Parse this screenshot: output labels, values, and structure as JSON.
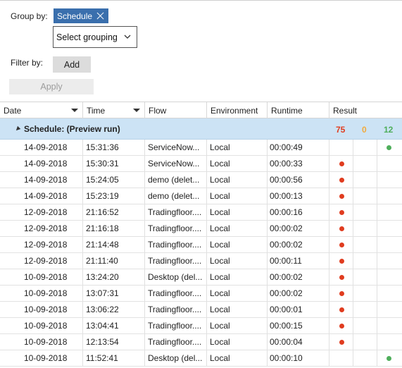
{
  "group_by": {
    "label": "Group by:",
    "chip_label": "Schedule",
    "select_value": "Select grouping"
  },
  "filter": {
    "label": "Filter by:",
    "add_label": "Add",
    "apply_label": "Apply"
  },
  "table": {
    "columns": [
      "Date",
      "Time",
      "Flow",
      "Environment",
      "Runtime",
      "Result"
    ],
    "group": {
      "title": "Schedule: (Preview run)",
      "count_fail": "75",
      "count_warn": "0",
      "count_ok": "12"
    },
    "rows": [
      {
        "date": "14-09-2018",
        "time": "15:31:36",
        "flow": "ServiceNow...",
        "env": "Local",
        "runtime": "00:00:49",
        "result": "ok"
      },
      {
        "date": "14-09-2018",
        "time": "15:30:31",
        "flow": "ServiceNow...",
        "env": "Local",
        "runtime": "00:00:33",
        "result": "fail"
      },
      {
        "date": "14-09-2018",
        "time": "15:24:05",
        "flow": "demo (delet...",
        "env": "Local",
        "runtime": "00:00:56",
        "result": "fail"
      },
      {
        "date": "14-09-2018",
        "time": "15:23:19",
        "flow": "demo (delet...",
        "env": "Local",
        "runtime": "00:00:13",
        "result": "fail"
      },
      {
        "date": "12-09-2018",
        "time": "21:16:52",
        "flow": "Tradingfloor....",
        "env": "Local",
        "runtime": "00:00:16",
        "result": "fail"
      },
      {
        "date": "12-09-2018",
        "time": "21:16:18",
        "flow": "Tradingfloor....",
        "env": "Local",
        "runtime": "00:00:02",
        "result": "fail"
      },
      {
        "date": "12-09-2018",
        "time": "21:14:48",
        "flow": "Tradingfloor....",
        "env": "Local",
        "runtime": "00:00:02",
        "result": "fail"
      },
      {
        "date": "12-09-2018",
        "time": "21:11:40",
        "flow": "Tradingfloor....",
        "env": "Local",
        "runtime": "00:00:11",
        "result": "fail"
      },
      {
        "date": "10-09-2018",
        "time": "13:24:20",
        "flow": "Desktop (del...",
        "env": "Local",
        "runtime": "00:00:02",
        "result": "fail"
      },
      {
        "date": "10-09-2018",
        "time": "13:07:31",
        "flow": "Tradingfloor....",
        "env": "Local",
        "runtime": "00:00:02",
        "result": "fail"
      },
      {
        "date": "10-09-2018",
        "time": "13:06:22",
        "flow": "Tradingfloor....",
        "env": "Local",
        "runtime": "00:00:01",
        "result": "fail"
      },
      {
        "date": "10-09-2018",
        "time": "13:04:41",
        "flow": "Tradingfloor....",
        "env": "Local",
        "runtime": "00:00:15",
        "result": "fail"
      },
      {
        "date": "10-09-2018",
        "time": "12:13:54",
        "flow": "Tradingfloor....",
        "env": "Local",
        "runtime": "00:00:04",
        "result": "fail"
      },
      {
        "date": "10-09-2018",
        "time": "11:52:41",
        "flow": "Desktop (del...",
        "env": "Local",
        "runtime": "00:00:10",
        "result": "ok"
      }
    ]
  },
  "colors": {
    "chip": "#3a6fad",
    "group_row": "#cce3f5",
    "fail": "#e03c1f",
    "warn": "#f2a93b",
    "ok": "#4fae5b"
  }
}
